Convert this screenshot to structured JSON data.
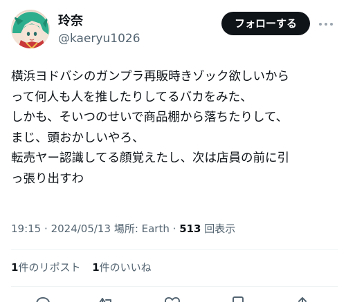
{
  "user": {
    "display_name": "玲奈",
    "handle": "@kaeryu1026"
  },
  "follow_button_label": "フォローする",
  "more_icon": "more-horizontal-icon",
  "tweet_lines": [
    "横浜ヨドバシのガンプラ再販時きゾック欲しいから",
    "って何人も人を推したりしてるバカをみた、",
    "しかも、そいつのせいで商品棚から落ちたりして、",
    "まじ、頭おかしいやろ、",
    "転売ヤー認識してる顔覚えたし、次は店員の前に引",
    "っ張り出すわ"
  ],
  "meta": {
    "time": "19:15",
    "date": "2024/05/13",
    "location_label": "場所: Earth",
    "views_count": "513",
    "views_label": "回表示"
  },
  "stats": {
    "reposts_count": "1",
    "reposts_label": "件のリポスト",
    "likes_count": "1",
    "likes_label": "件のいいね"
  },
  "action_icons": [
    "reply-icon",
    "repost-icon",
    "like-icon",
    "bookmark-icon",
    "share-icon"
  ],
  "colors": {
    "text": "#0f1419",
    "secondary": "#536471",
    "divider": "#eff3f4",
    "button_bg": "#0f1419",
    "button_text": "#ffffff"
  }
}
